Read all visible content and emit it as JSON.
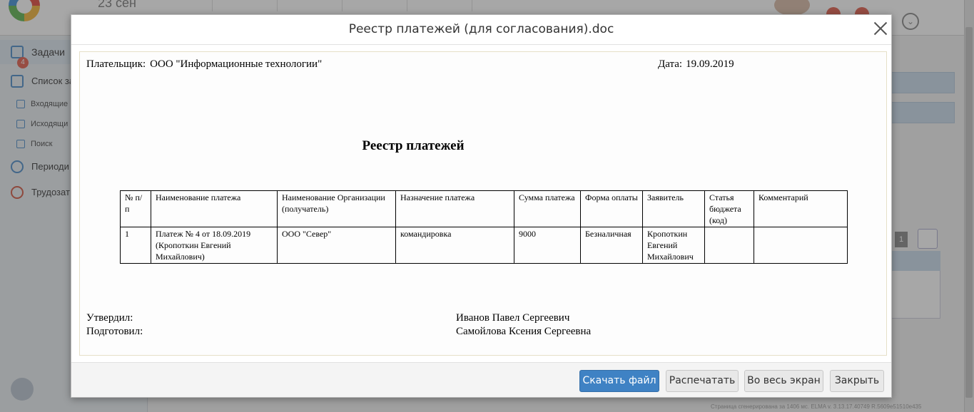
{
  "background": {
    "date_label": "23 сен",
    "sidebar": {
      "tasks": {
        "label": "Задачи",
        "badge": "4"
      },
      "task_list": "Список за",
      "incoming": "Входящие",
      "outgoing": "Исходящи",
      "search": "Поиск",
      "periodic": "Периоди",
      "labor": "Трудозат"
    },
    "pager_page": "1",
    "footer_note": "Страница сгенерирована за 1406 мс. ELMA v. 3.13.17.40749 R.5609e51510e435"
  },
  "modal": {
    "title": "Реестр платежей (для согласования).doc",
    "document": {
      "payer_label": "Плательщик:",
      "payer_value": "ООО \"Информационные технологии\"",
      "date_label": "Дата:",
      "date_value": "19.09.2019",
      "heading": "Реестр платежей",
      "columns": [
        "№ п/п",
        "Наименование платежа",
        "Наименование Организации (получатель)",
        "Назначение платежа",
        "Сумма платежа",
        "Форма оплаты",
        "Заявитель",
        "Статья бюджета (код)",
        "Комментарий"
      ],
      "rows": [
        {
          "num": "1",
          "payment_name": "Платеж № 4 от 18.09.2019 (Кропоткин Евгений Михайлович)",
          "organization": "ООО \"Север\"",
          "purpose": "командировка",
          "amount": "9000",
          "payment_form": "Безналичная",
          "applicant": "Кропоткин Евгений Михайлович",
          "budget_item": "",
          "comment": ""
        }
      ],
      "approved_label": "Утвердил:",
      "approved_name": "Иванов Павел Сергеевич",
      "prepared_label": "Подготовил:",
      "prepared_name": "Самойлова Ксения Сергеевна"
    },
    "buttons": {
      "download": "Скачать файл",
      "print": "Распечатать",
      "fullscreen": "Во весь экран",
      "close": "Закрыть"
    }
  },
  "colors": {
    "primary_button": "#3f82c4",
    "overlay": "rgba(60,60,60,0.45)"
  }
}
